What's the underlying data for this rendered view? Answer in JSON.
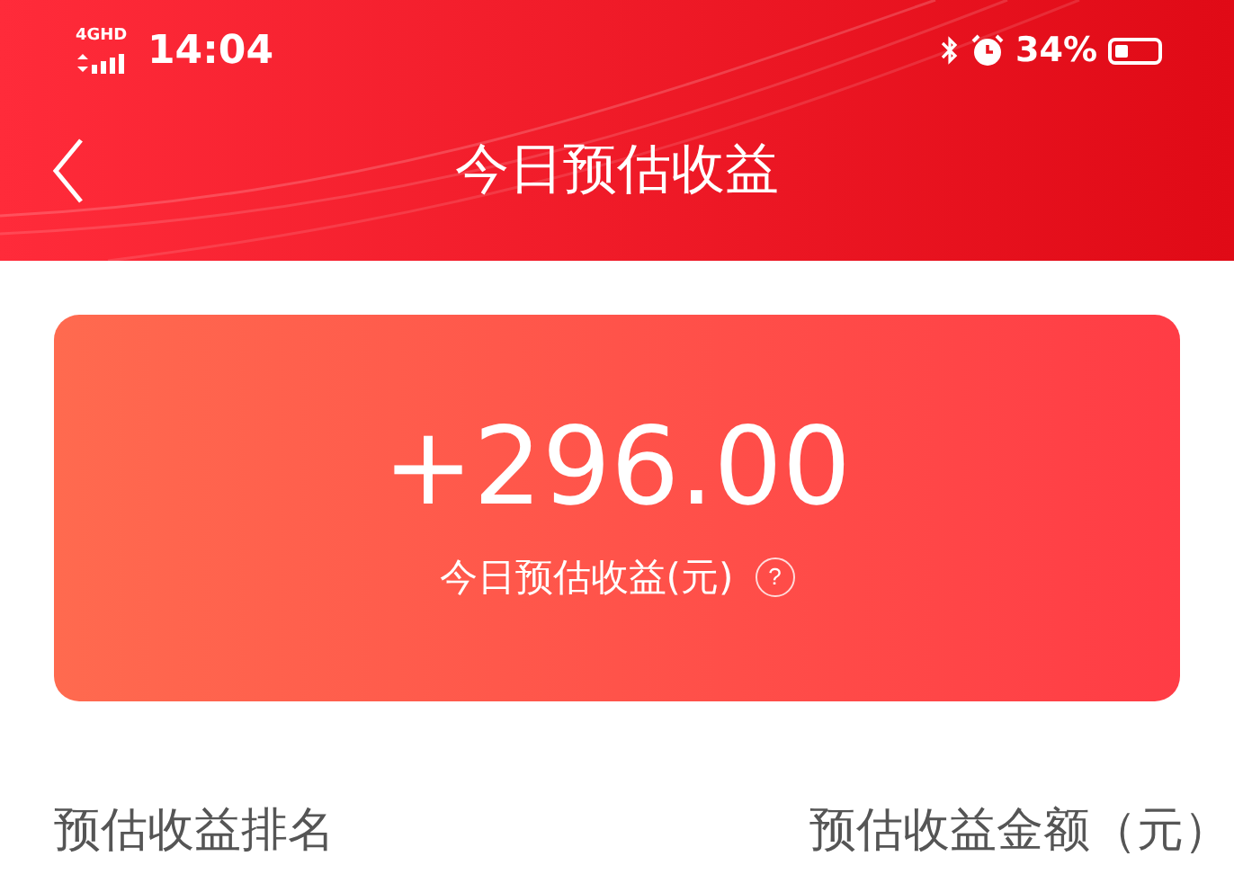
{
  "status_bar": {
    "network": "4GHD",
    "time": "14:04",
    "battery_text": "34%"
  },
  "nav": {
    "title": "今日预估收益"
  },
  "summary": {
    "amount": "+296.00",
    "label": "今日预估收益(元)",
    "help": "?"
  },
  "list_header": {
    "column_1": "预估收益排名",
    "column_2": "预估收益金额（元）"
  }
}
